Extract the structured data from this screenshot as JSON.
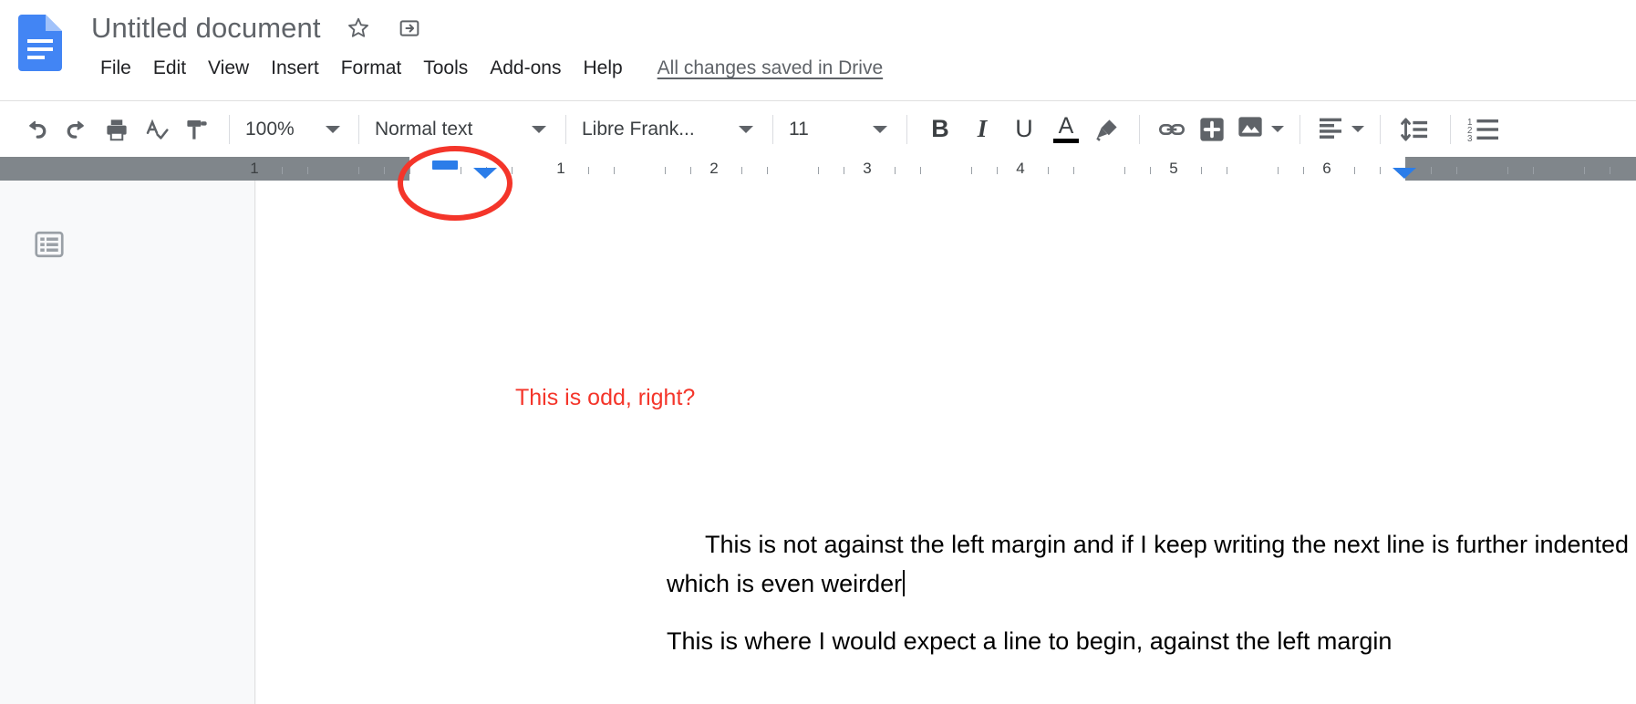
{
  "app": {
    "name": "Google Docs",
    "logo_icon": "google-docs-icon"
  },
  "header": {
    "title": "Untitled document",
    "star_icon": "star-icon",
    "move_folder_icon": "move-to-folder-icon",
    "menus": [
      "File",
      "Edit",
      "View",
      "Insert",
      "Format",
      "Tools",
      "Add-ons",
      "Help"
    ],
    "save_status": "All changes saved in Drive"
  },
  "toolbar": {
    "undo_icon": "undo-icon",
    "redo_icon": "redo-icon",
    "print_icon": "print-icon",
    "spellcheck_icon": "spellcheck-icon",
    "paint_format_icon": "paint-format-icon",
    "zoom_value": "100%",
    "style_value": "Normal text",
    "font_value": "Libre Frank...",
    "font_size_value": "11",
    "bold_label": "B",
    "italic_label": "I",
    "underline_label": "U",
    "text_color_label": "A",
    "text_color_swatch": "#000000",
    "highlight_icon": "highlight-pen-icon",
    "link_icon": "insert-link-icon",
    "comment_icon": "add-comment-icon",
    "image_icon": "insert-image-icon",
    "align_icon": "align-left-icon",
    "line_spacing_icon": "line-spacing-icon",
    "numbered_list_icon": "numbered-list-icon"
  },
  "ruler": {
    "numbers": [
      "1",
      "1",
      "2",
      "3",
      "4",
      "5",
      "6"
    ],
    "first_line_indent_marker": "first-line-indent-marker",
    "left_indent_marker": "left-indent-marker",
    "right_indent_marker": "right-indent-marker",
    "marker_color": "#2b7de9"
  },
  "sidebar": {
    "outline_icon": "document-outline-icon"
  },
  "document": {
    "annotation_text": "This is odd, right?",
    "annotation_color": "#f4352a",
    "annotation_ellipse": "red-ellipse-annotation",
    "paragraph_1": "This is not against the left margin and if I keep writing the next line is further indented which is even weirder",
    "paragraph_2": "This is where I would expect a line to begin, against the left margin"
  }
}
